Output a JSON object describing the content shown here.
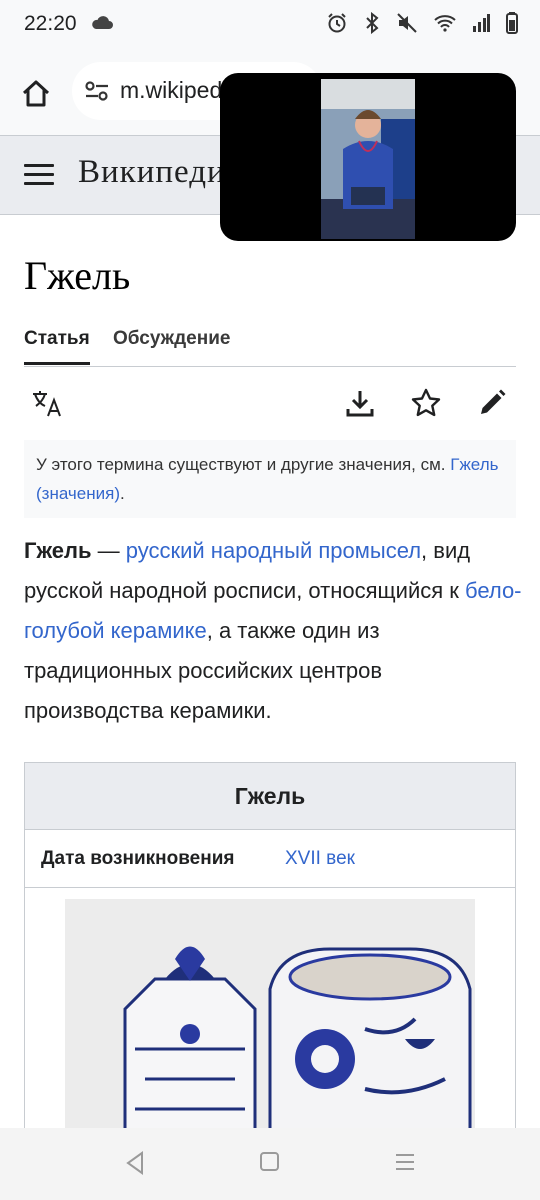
{
  "status": {
    "time": "22:20",
    "icons": [
      "cloud-icon",
      "alarm-icon",
      "bluetooth-icon",
      "mute-icon",
      "wifi-icon",
      "signal-icon",
      "battery-icon"
    ]
  },
  "browser": {
    "url": "m.wikipedia.org"
  },
  "wiki": {
    "logo": "Википедия"
  },
  "article": {
    "title": "Гжель",
    "tabs": [
      "Статья",
      "Обсуждение"
    ],
    "hatnote_prefix": "У этого термина существуют и другие значения, см. ",
    "hatnote_link": "Гжель (значения)",
    "hatnote_suffix": ".",
    "lead": {
      "bold": "Гжель",
      "dash": " — ",
      "link1": "русский народный промысел",
      "text1": ", вид русской народной росписи, относящийся к ",
      "link2": "бело-голубой керамике",
      "text2": ", а также один из традиционных российских центров производства керамики."
    },
    "infobox": {
      "title": "Гжель",
      "row_label": "Дата возникновения",
      "row_value": "XVII век"
    }
  },
  "colors": {
    "link": "#3366cc",
    "header_bg": "#eaecf0"
  }
}
